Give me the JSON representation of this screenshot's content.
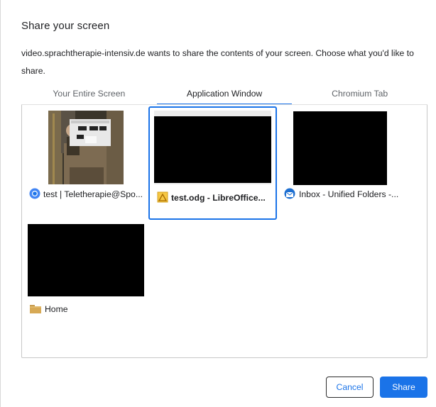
{
  "dialog": {
    "title": "Share your screen",
    "description": "video.sprachtherapie-intensiv.de wants to share the contents of your screen. Choose what you'd like to share."
  },
  "tabs": [
    {
      "label": "Your Entire Screen",
      "active": false
    },
    {
      "label": "Application Window",
      "active": true
    },
    {
      "label": "Chromium Tab",
      "active": false
    }
  ],
  "windows": [
    {
      "label": "test | Teletherapie@Spo...",
      "icon": "chromium-icon",
      "selected": false
    },
    {
      "label": "test.odg - LibreOffice...",
      "icon": "libreoffice-draw-icon",
      "selected": true
    },
    {
      "label": "Inbox - Unified Folders -...",
      "icon": "thunderbird-icon",
      "selected": false
    },
    {
      "label": "Home",
      "icon": "folder-icon",
      "selected": false
    }
  ],
  "buttons": {
    "cancel": "Cancel",
    "share": "Share"
  },
  "colors": {
    "accent": "#1a73e8",
    "thumbnail_bg": "#000000"
  }
}
